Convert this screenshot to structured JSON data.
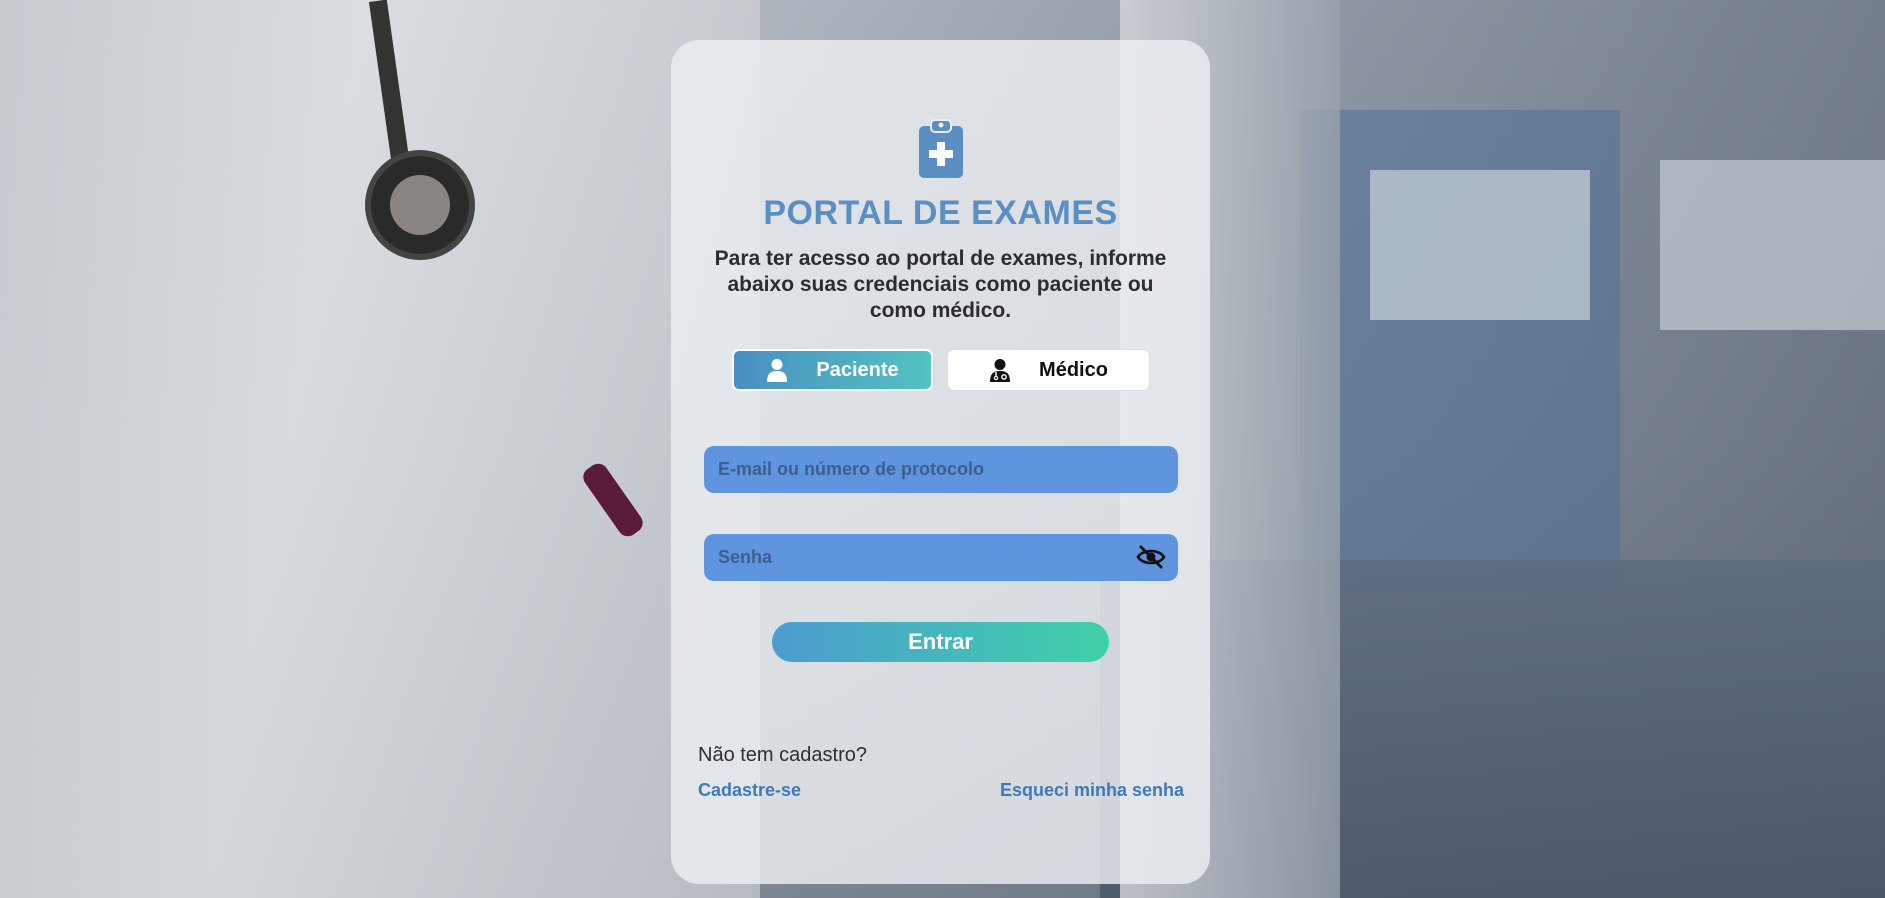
{
  "header": {
    "logo_icon": "clipboard-medical-icon",
    "title": "PORTAL DE EXAMES",
    "subtitle": "Para ter acesso ao portal de exames, informe abaixo suas credenciais como paciente ou como médico."
  },
  "role_toggle": {
    "patient_label": "Paciente",
    "patient_icon": "user-icon",
    "doctor_label": "Médico",
    "doctor_icon": "doctor-icon",
    "selected": "Paciente"
  },
  "form": {
    "login_placeholder": "E-mail ou número de protocolo",
    "login_value": "",
    "password_placeholder": "Senha",
    "password_value": "",
    "password_toggle_icon": "eye-slash-icon",
    "submit_label": "Entrar"
  },
  "footer": {
    "no_account_text": "Não tem cadastro?",
    "signup_link": "Cadastre-se",
    "forgot_link": "Esqueci minha senha"
  },
  "colors": {
    "accent": "#5b8ec3",
    "input_bg": "#5f94df",
    "button_gradient_start": "#4d9cd0",
    "button_gradient_end": "#3fd1a8",
    "link": "#3f7ab8"
  }
}
